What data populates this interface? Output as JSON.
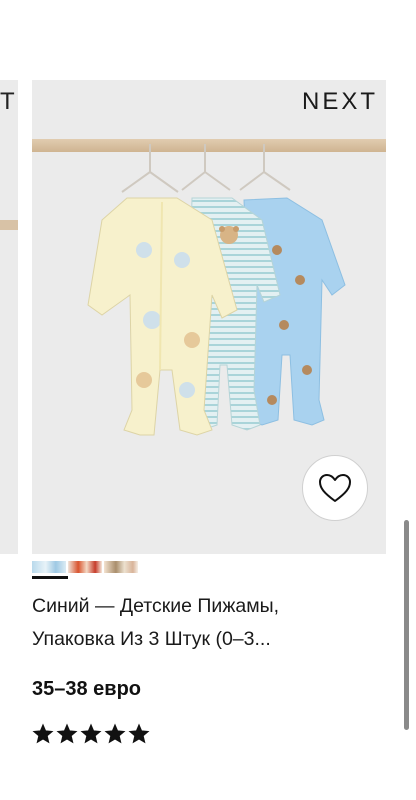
{
  "prev_card": {
    "brand": "T"
  },
  "product": {
    "brand": "NEXT",
    "title_line1": "Синий — Детские Пижамы,",
    "title_line2": "Упаковка Из 3 Штук (0–3...",
    "price": "35–38 евро",
    "rating_stars": 5,
    "swatches": [
      {
        "name": "blue",
        "selected": true
      },
      {
        "name": "red-pattern",
        "selected": false
      },
      {
        "name": "neutral-pattern",
        "selected": false
      }
    ],
    "favorite_icon": "heart-outline-icon"
  },
  "colors": {
    "card_bg": "#ebebeb",
    "rail": "#d8c2a6",
    "text": "#1a1a1a"
  }
}
